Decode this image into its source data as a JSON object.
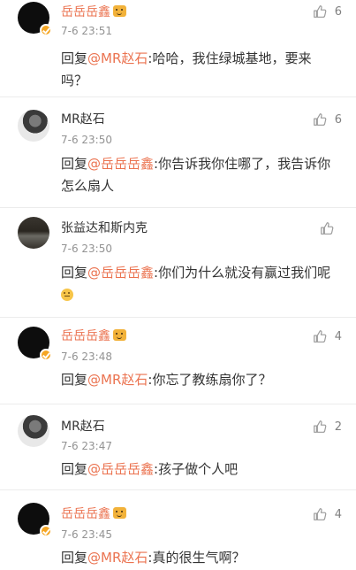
{
  "comments": [
    {
      "username": "岳岳岳鑫",
      "name_style": "orange",
      "avatar_style": "dark",
      "verified": true,
      "crown_emoji": true,
      "time": "7-6 23:51",
      "likes": "6",
      "reply_prefix": "回复",
      "mention": "@MR赵石",
      "text": ":哈哈，我住绿城基地，要来吗？",
      "end_emoji": false
    },
    {
      "username": "MR赵石",
      "name_style": "plain",
      "avatar_style": "photo",
      "verified": false,
      "crown_emoji": false,
      "time": "7-6 23:50",
      "likes": "6",
      "reply_prefix": "回复",
      "mention": "@岳岳岳鑫",
      "text": ":你告诉我你住哪了，我告诉你怎么扇人",
      "end_emoji": false
    },
    {
      "username": "张益达和斯内克",
      "name_style": "plain",
      "avatar_style": "group",
      "verified": false,
      "crown_emoji": false,
      "time": "7-6 23:50",
      "likes": "",
      "reply_prefix": "回复",
      "mention": "@岳岳岳鑫",
      "text": ":你们为什么就没有赢过我们呢",
      "end_emoji": true
    },
    {
      "username": "岳岳岳鑫",
      "name_style": "orange",
      "avatar_style": "dark",
      "verified": true,
      "crown_emoji": true,
      "time": "7-6 23:48",
      "likes": "4",
      "reply_prefix": "回复",
      "mention": "@MR赵石",
      "text": ":你忘了教练扇你了？",
      "end_emoji": false
    },
    {
      "username": "MR赵石",
      "name_style": "plain",
      "avatar_style": "photo",
      "verified": false,
      "crown_emoji": false,
      "time": "7-6 23:47",
      "likes": "2",
      "reply_prefix": "回复",
      "mention": "@岳岳岳鑫",
      "text": ":孩子做个人吧",
      "end_emoji": false
    },
    {
      "username": "岳岳岳鑫",
      "name_style": "orange",
      "avatar_style": "dark",
      "verified": true,
      "crown_emoji": true,
      "time": "7-6 23:45",
      "likes": "4",
      "reply_prefix": "回复",
      "mention": "@MR赵石",
      "text": ":真的很生气啊？",
      "end_emoji": false
    }
  ],
  "icons": {
    "like": "thumbs-up-icon",
    "verified": "verified-badge-icon",
    "emoji": "emoji-icon"
  },
  "colors": {
    "mention": "#eb7350",
    "username_highlight": "#eb7350",
    "time": "#939393",
    "verified_badge": "#f5a623"
  }
}
